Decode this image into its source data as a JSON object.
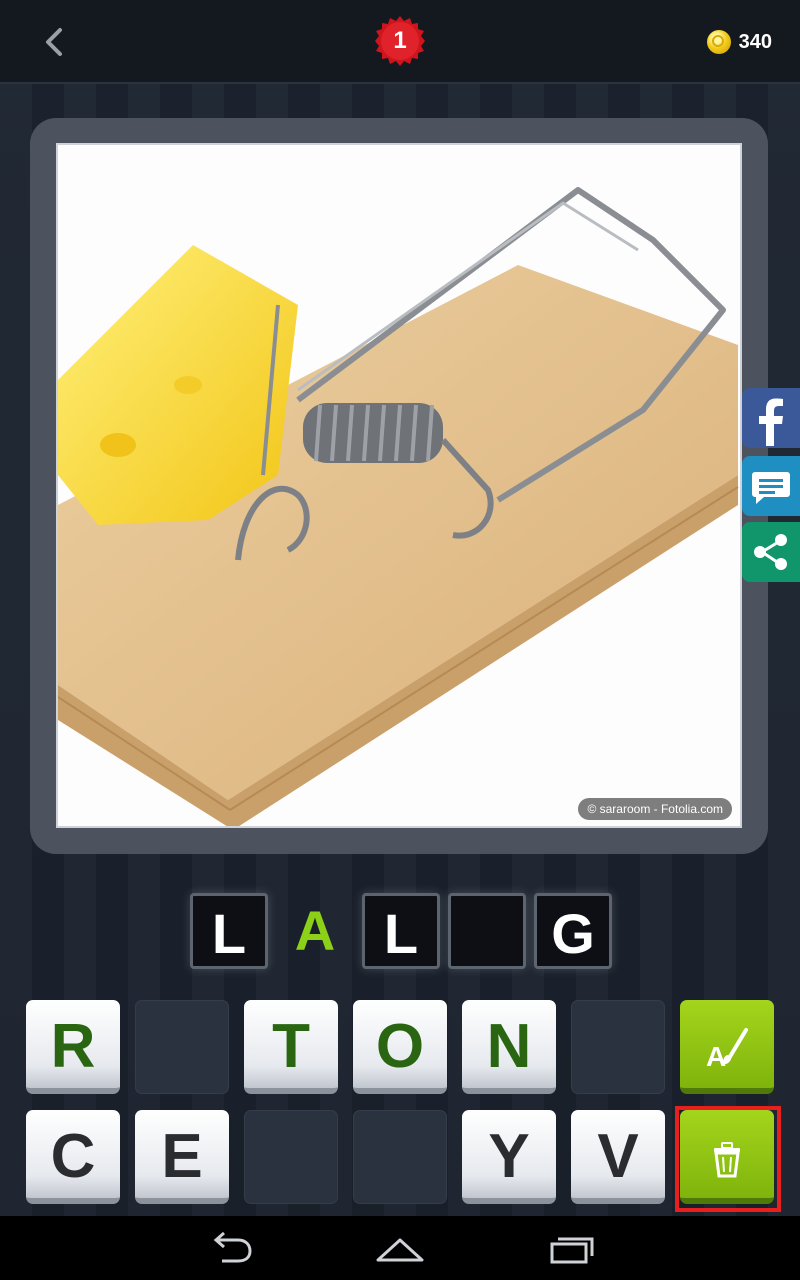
{
  "header": {
    "level": "1",
    "coins": "340"
  },
  "photo": {
    "credit": "© sararoom - Fotolia.com"
  },
  "answer": [
    {
      "letter": "L",
      "style": "filled"
    },
    {
      "letter": "A",
      "style": "green"
    },
    {
      "letter": "L",
      "style": "filled"
    },
    {
      "letter": "",
      "style": "filled"
    },
    {
      "letter": "G",
      "style": "filled"
    }
  ],
  "keyboard": {
    "row1": [
      "R",
      "",
      "T",
      "O",
      "N",
      ""
    ],
    "row2": [
      "C",
      "E",
      "",
      "",
      "Y",
      "V"
    ]
  },
  "colors": {
    "accent_green": "#8cd118",
    "tile_letter_green": "#2a6612",
    "level_badge": "#d0141c",
    "highlight": "#e8201d"
  }
}
